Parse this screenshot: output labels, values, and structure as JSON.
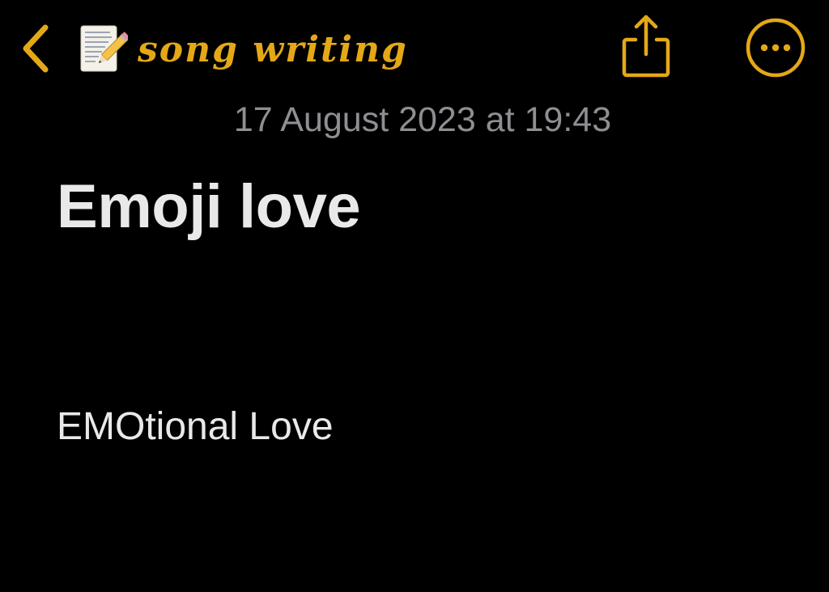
{
  "colors": {
    "background": "#000000",
    "accent": "#e4a817",
    "secondary_text": "#8e8e93",
    "primary_text": "#e9e9ea"
  },
  "nav": {
    "back_icon": "chevron-left-icon",
    "folder_icon": "memo-icon",
    "folder_title": "song writing",
    "share_icon": "share-icon",
    "more_icon": "ellipsis-circle-icon"
  },
  "note": {
    "date": "17 August 2023 at 19:43",
    "title": "Emoji love",
    "body": "EMOtional Love"
  }
}
